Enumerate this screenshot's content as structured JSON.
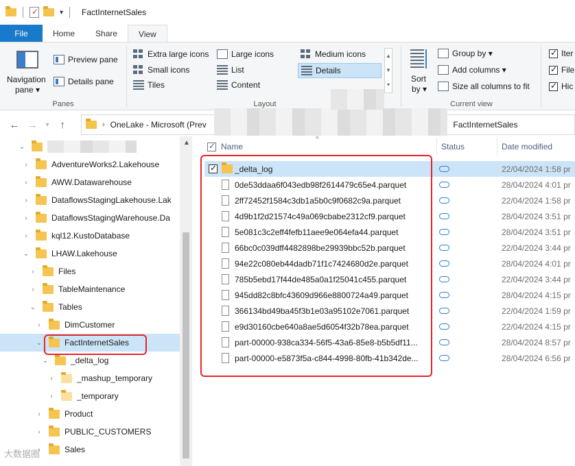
{
  "window": {
    "title": "FactInternetSales"
  },
  "ribbon": {
    "tabs": [
      "File",
      "Home",
      "Share",
      "View"
    ],
    "panes": {
      "navigation_pane": "Navigation",
      "navigation_pane_2": "pane ▾",
      "preview_pane": "Preview pane",
      "details_pane": "Details pane",
      "label": "Panes"
    },
    "layout": {
      "items": [
        "Extra large icons",
        "Large icons",
        "Medium icons",
        "Small icons",
        "List",
        "Details",
        "Tiles",
        "Content"
      ],
      "label": "Layout"
    },
    "current_view": {
      "sort": "Sort",
      "sort_by": "by ▾",
      "group_by": "Group by ▾",
      "add_columns": "Add columns ▾",
      "size_all": "Size all columns to fit",
      "label": "Current view"
    },
    "show_hide": [
      "Iter",
      "File",
      "Hic"
    ]
  },
  "address": {
    "segments": [
      "OneLake - Microsoft (Prev",
      "FactInternetSales"
    ]
  },
  "tree": {
    "items": [
      {
        "label": "",
        "indent": 0
      },
      {
        "label": "AdventureWorks2.Lakehouse"
      },
      {
        "label": "AWW.Datawarehouse"
      },
      {
        "label": "DataflowsStagingLakehouse.Lak"
      },
      {
        "label": "DataflowsStagingWarehouse.Da"
      },
      {
        "label": "kql12.KustoDatabase"
      },
      {
        "label": "LHAW.Lakehouse"
      },
      {
        "label": "Files"
      },
      {
        "label": "TableMaintenance"
      },
      {
        "label": "Tables"
      },
      {
        "label": "DimCustomer"
      },
      {
        "label": "FactInternetSales"
      },
      {
        "label": "_delta_log"
      },
      {
        "label": "_mashup_temporary"
      },
      {
        "label": "_temporary"
      },
      {
        "label": "Product"
      },
      {
        "label": "PUBLIC_CUSTOMERS"
      },
      {
        "label": "Sales"
      }
    ]
  },
  "list": {
    "columns": {
      "name": "Name",
      "status": "Status",
      "date": "Date modified"
    },
    "rows": [
      {
        "name": "_delta_log",
        "date": "22/04/2024 1:58 pr"
      },
      {
        "name": "0de53ddaa6f043edb98f2614479c65e4.parquet",
        "date": "28/04/2024 4:01 pr"
      },
      {
        "name": "2ff72452f1584c3db1a5b0c9f0682c9a.parquet",
        "date": "22/04/2024 1:58 pr"
      },
      {
        "name": "4d9b1f2d21574c49a069cbabe2312cf9.parquet",
        "date": "28/04/2024 3:51 pr"
      },
      {
        "name": "5e081c3c2eff4fefb11aee9e064efa44.parquet",
        "date": "28/04/2024 3:51 pr"
      },
      {
        "name": "66bc0c039dff4482898be29939bbc52b.parquet",
        "date": "22/04/2024 3:44 pr"
      },
      {
        "name": "94e22c080eb44dadb71f1c7424680d2e.parquet",
        "date": "28/04/2024 4:01 pr"
      },
      {
        "name": "785b5ebd17f44de485a0a1f25041c455.parquet",
        "date": "22/04/2024 3:44 pr"
      },
      {
        "name": "945dd82c8bfc43609d966e8800724a49.parquet",
        "date": "28/04/2024 4:15 pr"
      },
      {
        "name": "366134bd49ba45f3b1e03a95102e7061.parquet",
        "date": "22/04/2024 1:59 pr"
      },
      {
        "name": "e9d30160cbe640a8ae5d6054f32b78ea.parquet",
        "date": "22/04/2024 4:15 pr"
      },
      {
        "name": "part-00000-938ca334-56f5-43a6-85e8-b5b5df11...",
        "date": "28/04/2024 8:57 pr"
      },
      {
        "name": "part-00000-e5873f5a-c844-4998-80fb-41b342de...",
        "date": "28/04/2024 6:56 pr"
      }
    ]
  },
  "watermark": "大数据圈"
}
